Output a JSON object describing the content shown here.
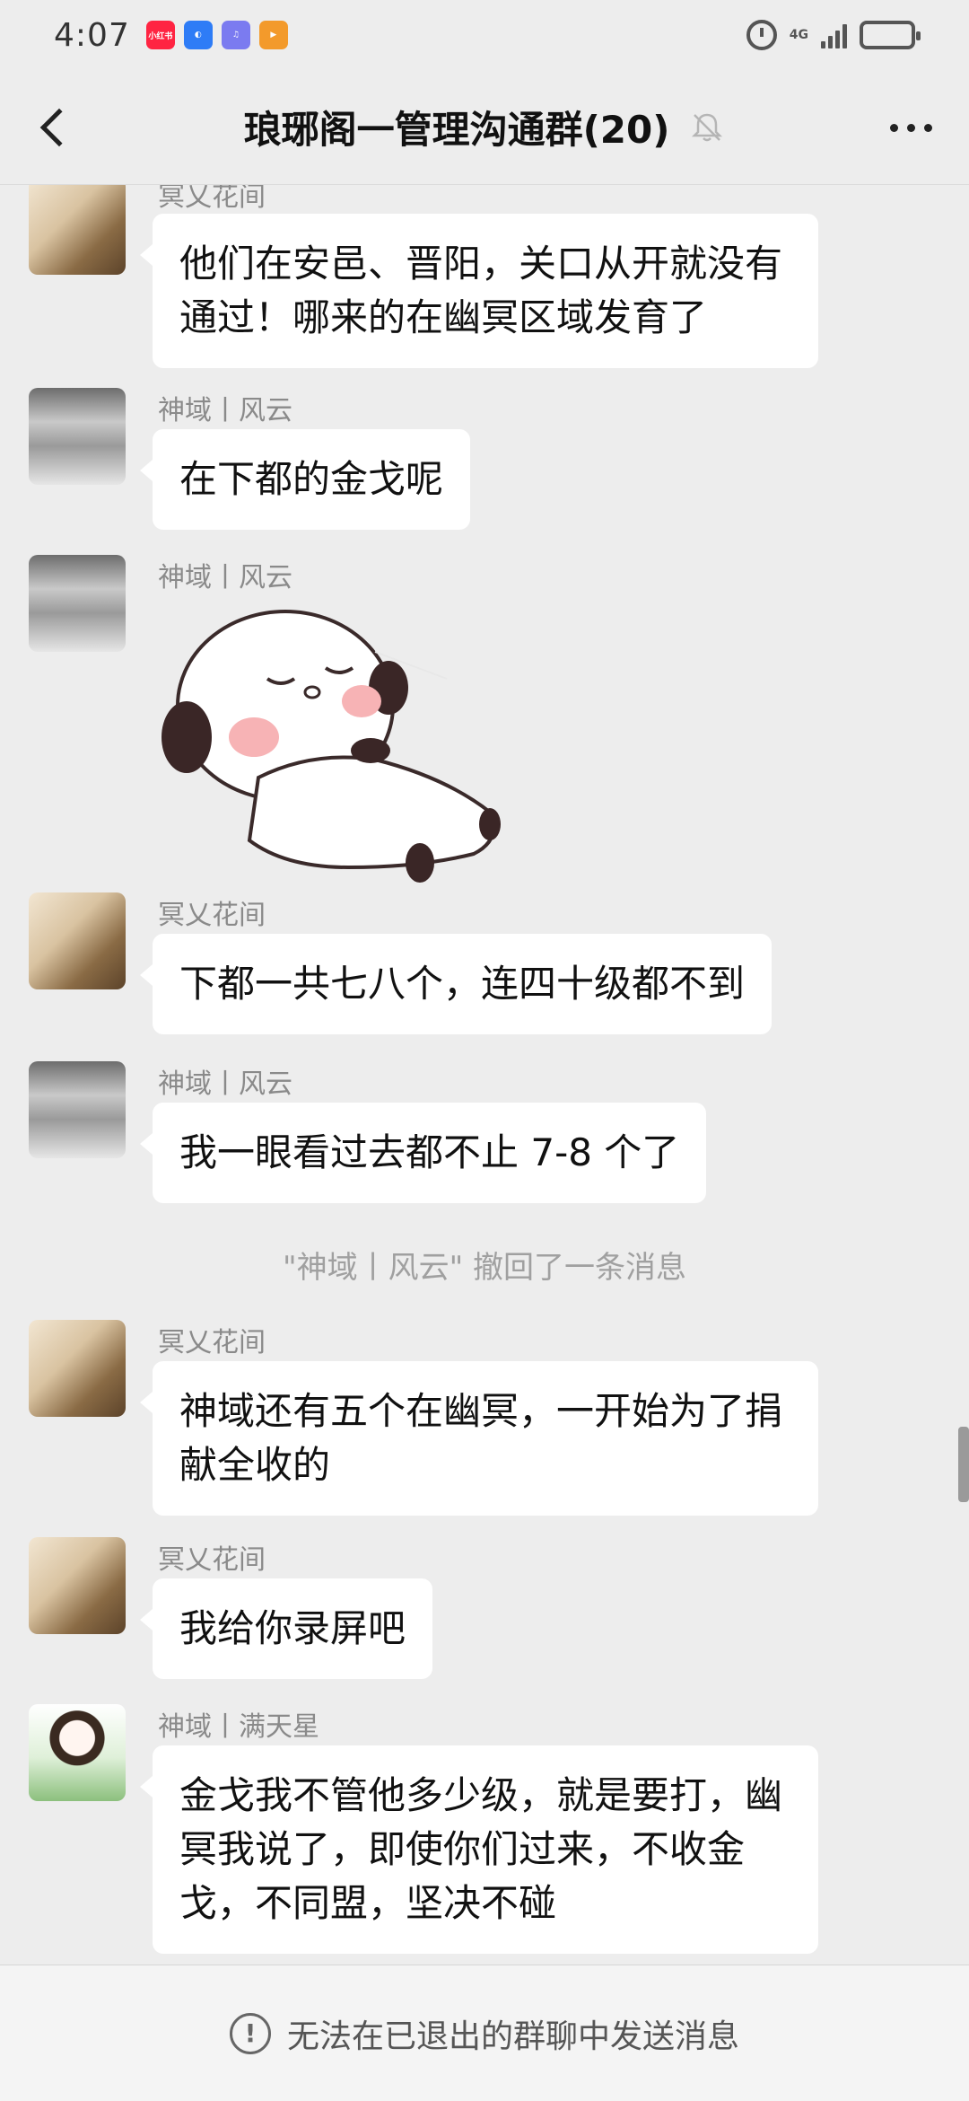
{
  "status_bar": {
    "time": "4:07",
    "network": "4G",
    "apps": [
      {
        "name": "xiaohongshu",
        "label": "小红书",
        "color": "#ff2442"
      },
      {
        "name": "app-blue",
        "label": "",
        "color": "#2e7cf6"
      },
      {
        "name": "music",
        "label": "",
        "color": "#7b7bf0"
      },
      {
        "name": "video",
        "label": "",
        "color": "#f39a2b"
      }
    ]
  },
  "header": {
    "title": "琅琊阁一管理沟通群(20)",
    "muted": true
  },
  "messages": [
    {
      "sender": "冥乂花间",
      "avatar": "groot",
      "text": "他们在安邑、晋阳，关口从开就没有通过！哪来的在幽冥区域发育了"
    },
    {
      "sender": "神域丨风云",
      "avatar": "snow",
      "text": "在下都的金戈呢"
    },
    {
      "sender": "神域丨风云",
      "avatar": "snow",
      "sticker": "sleeping-panda-sticker"
    },
    {
      "sender": "冥乂花间",
      "avatar": "groot",
      "text": "下都一共七八个，连四十级都不到"
    },
    {
      "sender": "神域丨风云",
      "avatar": "snow",
      "text": "我一眼看过去都不止 7-8 个了"
    },
    {
      "system": "\"神域丨风云\" 撤回了一条消息"
    },
    {
      "sender": "冥乂花间",
      "avatar": "groot",
      "text": "神域还有五个在幽冥，一开始为了捐献全收的"
    },
    {
      "sender": "冥乂花间",
      "avatar": "groot",
      "text": "我给你录屏吧"
    },
    {
      "sender": "神域丨满天星",
      "avatar": "girl",
      "text": "金戈我不管他多少级，就是要打，幽冥我说了，即使你们过来，不收金戈，不同盟，坚决不碰"
    }
  ],
  "footer": {
    "notice": "无法在已退出的群聊中发送消息"
  }
}
